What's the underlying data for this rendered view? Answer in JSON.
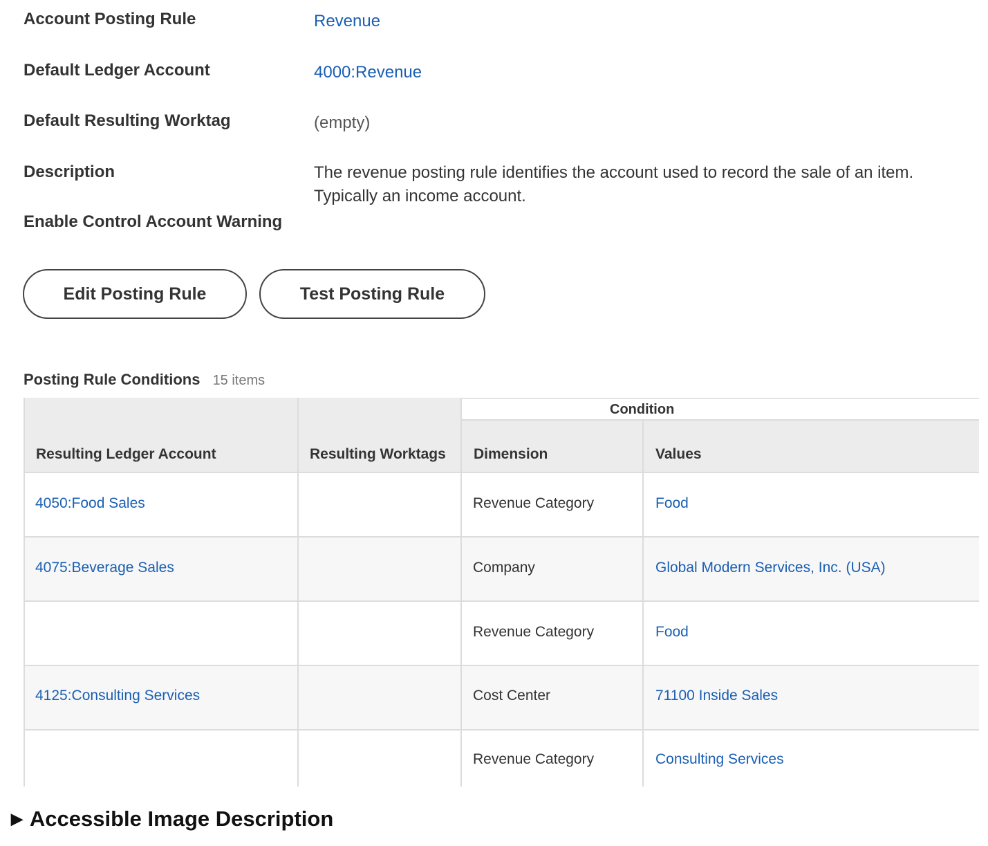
{
  "details": {
    "account_posting_rule": {
      "label": "Account Posting Rule",
      "value": "Revenue"
    },
    "default_ledger_account": {
      "label": "Default Ledger Account",
      "value": "4000:Revenue"
    },
    "default_resulting_worktag": {
      "label": "Default Resulting Worktag",
      "value": "(empty)"
    },
    "description": {
      "label": "Description",
      "value": "The revenue posting rule identifies the account used to record the sale of an item. Typically an income account."
    },
    "enable_control_account_warning": {
      "label": "Enable Control Account Warning"
    }
  },
  "buttons": {
    "edit": "Edit Posting Rule",
    "test": "Test Posting Rule"
  },
  "conditions": {
    "title": "Posting Rule Conditions",
    "count": "15 items",
    "group_header": "Condition",
    "headers": {
      "ledger": "Resulting Ledger Account",
      "worktags": "Resulting Worktags",
      "dimension": "Dimension",
      "values": "Values"
    },
    "rows": [
      {
        "ledger": "4050:Food Sales",
        "worktags": "",
        "dimension": "Revenue Category",
        "values": "Food"
      },
      {
        "ledger": "4075:Beverage Sales",
        "worktags": "",
        "dimension": "Company",
        "values": "Global Modern Services, Inc. (USA)"
      },
      {
        "ledger": "",
        "worktags": "",
        "dimension": "Revenue Category",
        "values": "Food"
      },
      {
        "ledger": "4125:Consulting Services",
        "worktags": "",
        "dimension": "Cost Center",
        "values": "71100 Inside Sales"
      },
      {
        "ledger": "",
        "worktags": "",
        "dimension": "Revenue Category",
        "values": "Consulting Services"
      }
    ]
  },
  "footer": {
    "label": "Accessible Image Description"
  },
  "colors": {
    "link": "#1a5fb4",
    "header_bg": "#ececec",
    "text": "#333333"
  }
}
